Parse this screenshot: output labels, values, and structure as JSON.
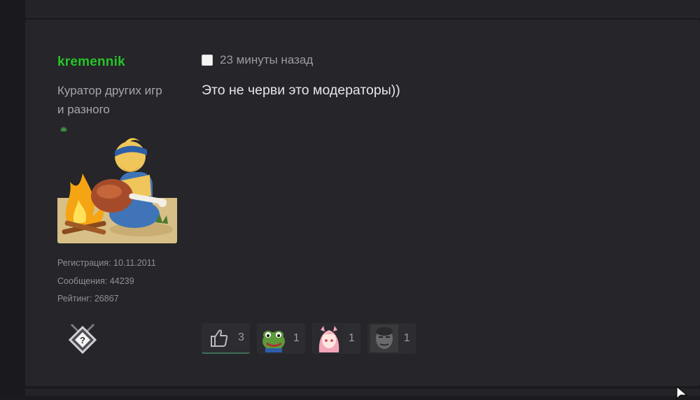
{
  "post": {
    "author": {
      "username": "kremennik",
      "title": "Куратор других игр и разного",
      "stats": {
        "registration": "Регистрация: 10.11.2011",
        "messages": "Сообщения: 44239",
        "rating": "Рейтинг: 26867"
      },
      "online": true
    },
    "time": "23 минуты назад",
    "message": "Это не черви это модераторы))",
    "reactions": [
      {
        "icon": "thumbs-up-icon",
        "count": "3"
      },
      {
        "icon": "pepe-emoji-icon",
        "count": "1"
      },
      {
        "icon": "anime-girl-emoji-icon",
        "count": "1"
      },
      {
        "icon": "face-emoji-icon",
        "count": "1"
      }
    ]
  },
  "colors": {
    "username": "#27c427",
    "page_bg": "#1b1b1f",
    "post_bg": "#25252a"
  }
}
